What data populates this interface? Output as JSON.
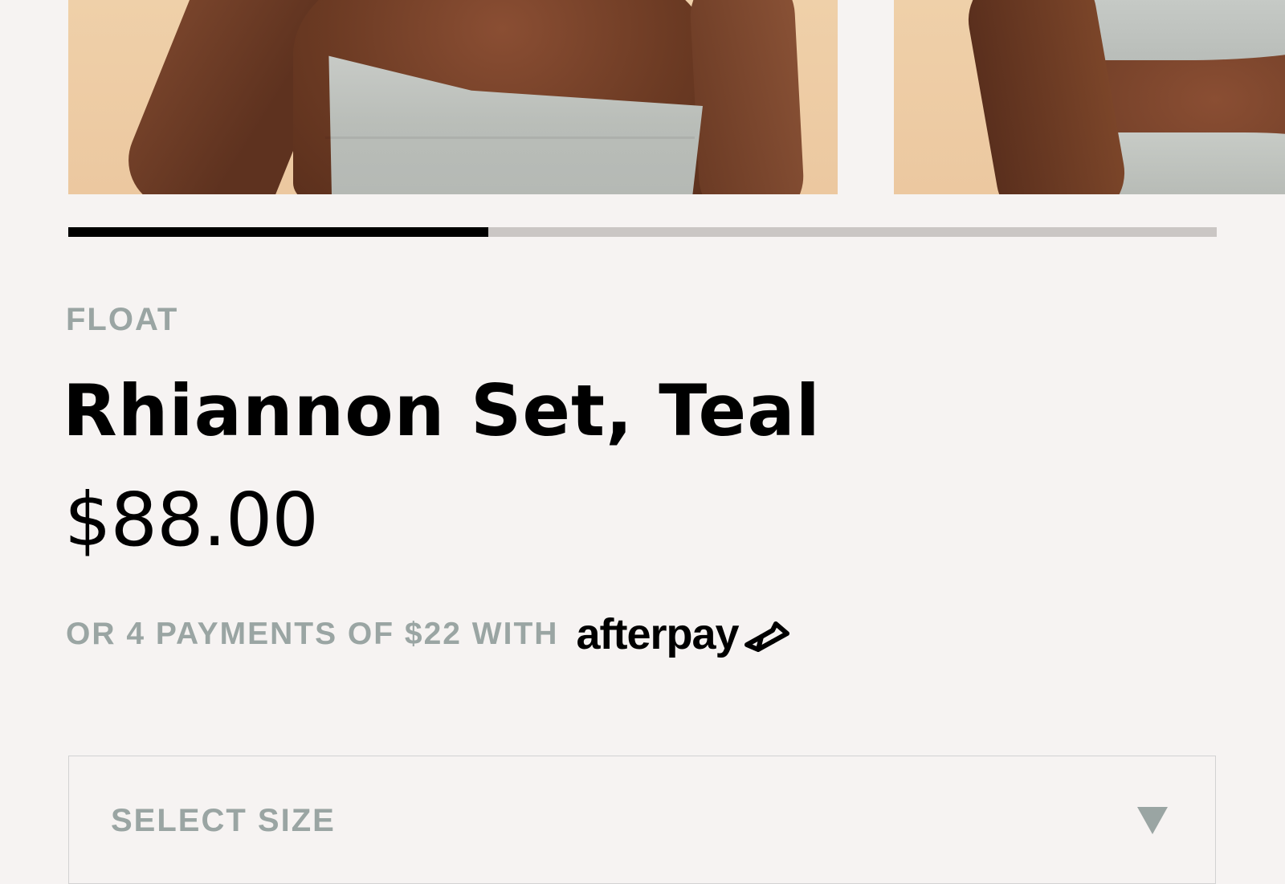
{
  "carousel": {
    "slides": [
      "product-photo-front",
      "product-photo-side"
    ],
    "progress_fraction": 0.366
  },
  "product": {
    "brand": "FLOAT",
    "title": "Rhiannon Set, Teal",
    "price": "$88.00"
  },
  "afterpay": {
    "text": "OR 4 PAYMENTS OF $22 WITH",
    "logo_text": "afterpay",
    "logo_icon": "afterpay-arrows-icon"
  },
  "size_select": {
    "placeholder": "SELECT SIZE",
    "icon": "triangle-down-icon"
  },
  "colors": {
    "background": "#f6f3f2",
    "muted_text": "#9aa5a3",
    "progress_active": "#000000",
    "progress_track": "#cac6c4"
  }
}
